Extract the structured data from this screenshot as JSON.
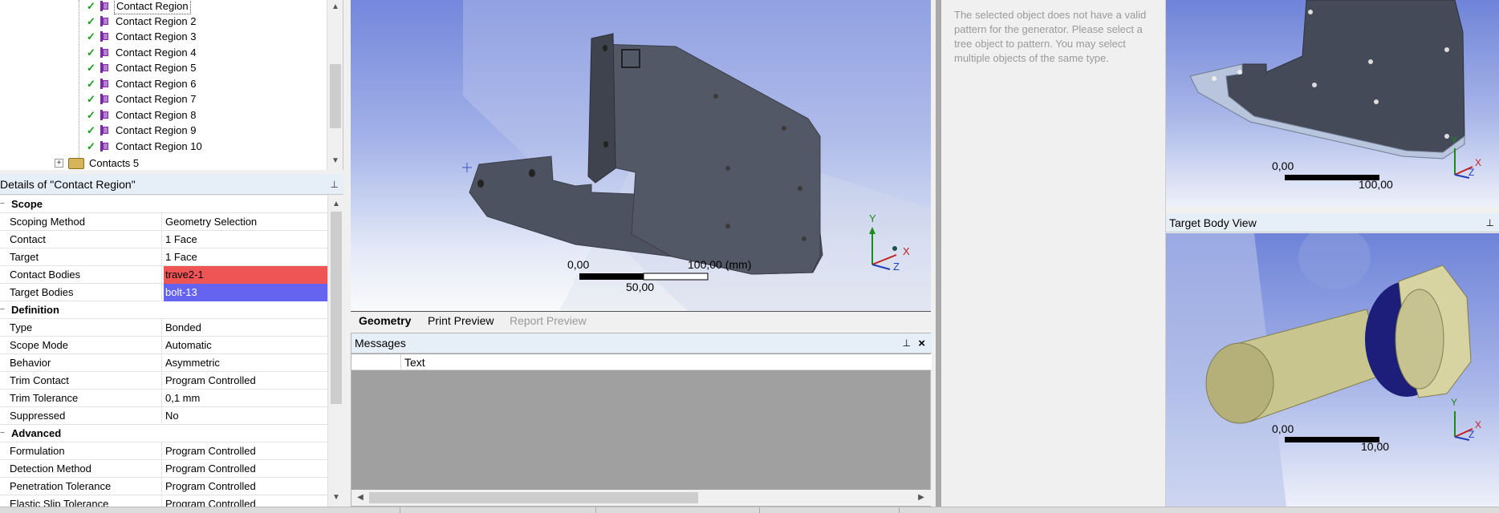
{
  "tree": {
    "items": [
      {
        "label": "Contact Region"
      },
      {
        "label": "Contact Region 2"
      },
      {
        "label": "Contact Region 3"
      },
      {
        "label": "Contact Region 4"
      },
      {
        "label": "Contact Region 5"
      },
      {
        "label": "Contact Region 6"
      },
      {
        "label": "Contact Region 7"
      },
      {
        "label": "Contact Region 8"
      },
      {
        "label": "Contact Region 9"
      },
      {
        "label": "Contact Region 10"
      }
    ],
    "group_label": "Contacts 5",
    "expand_symbol": "+",
    "check_glyph": "✓"
  },
  "details": {
    "title": "Details of \"Contact Region\"",
    "pin_glyph": "⊥",
    "collapse_glyph": "−",
    "sections": [
      {
        "title": "Scope",
        "rows": [
          {
            "key": "Scoping Method",
            "value": "Geometry Selection"
          },
          {
            "key": "Contact",
            "value": "1 Face"
          },
          {
            "key": "Target",
            "value": "1 Face"
          },
          {
            "key": "Contact Bodies",
            "value": "trave2-1",
            "highlight": "#f05555"
          },
          {
            "key": "Target Bodies",
            "value": "bolt-13",
            "highlight": "#6464f0"
          }
        ]
      },
      {
        "title": "Definition",
        "rows": [
          {
            "key": "Type",
            "value": "Bonded"
          },
          {
            "key": "Scope Mode",
            "value": "Automatic"
          },
          {
            "key": "Behavior",
            "value": "Asymmetric"
          },
          {
            "key": "Trim Contact",
            "value": "Program Controlled"
          },
          {
            "key": "Trim Tolerance",
            "value": "0,1 mm"
          },
          {
            "key": "Suppressed",
            "value": "No"
          }
        ]
      },
      {
        "title": "Advanced",
        "rows": [
          {
            "key": "Formulation",
            "value": "Program Controlled"
          },
          {
            "key": "Detection Method",
            "value": "Program Controlled"
          },
          {
            "key": "Penetration Tolerance",
            "value": "Program Controlled"
          },
          {
            "key": "Elastic Slip Tolerance",
            "value": "Program Controlled"
          }
        ]
      }
    ]
  },
  "viewport": {
    "scale": {
      "start": "0,00",
      "mid": "50,00",
      "end": "100,00 (mm)"
    },
    "axes": {
      "x": "X",
      "y": "Y",
      "z": "Z"
    }
  },
  "tabs": [
    {
      "label": "Geometry",
      "state": "active"
    },
    {
      "label": "Print Preview",
      "state": "normal"
    },
    {
      "label": "Report Preview",
      "state": "disabled"
    }
  ],
  "messages": {
    "title": "Messages",
    "column": "Text",
    "pin_glyph": "⊥",
    "close_glyph": "×"
  },
  "hint": {
    "text": "The selected object does not have a valid pattern for the generator. Please select a tree object to pattern. You may select multiple objects of the same type."
  },
  "contact_view": {
    "scale_start": "0,00",
    "scale_end": "100,00"
  },
  "target_body_view": {
    "title": "Target Body View",
    "pin_glyph": "⊥",
    "scale_start": "0,00",
    "scale_end": "10,00"
  },
  "colors": {
    "contact_body": "#f05555",
    "target_body": "#6464f0",
    "viewport_top": "#7487dc",
    "check": "#1a9a1a"
  }
}
